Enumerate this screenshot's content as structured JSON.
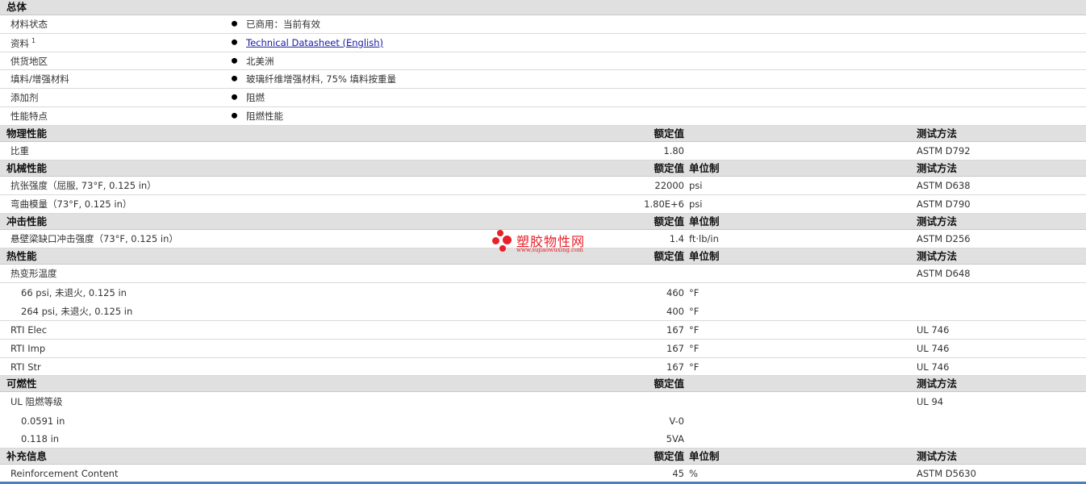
{
  "general": {
    "title": "总体",
    "rows": [
      {
        "label": "材料状态",
        "value": "已商用：当前有效"
      },
      {
        "label": "资料",
        "sup": "1",
        "value": "Technical Datasheet (English)"
      },
      {
        "label": "供货地区",
        "value": "北美洲"
      },
      {
        "label": "填料/增强材料",
        "value": "玻璃纤维增强材料, 75% 填料按重量"
      },
      {
        "label": "添加剂",
        "value": "阻燃"
      },
      {
        "label": "性能特点",
        "value": "阻燃性能"
      }
    ]
  },
  "col_headers": {
    "nominal": "额定值",
    "unit": "单位制",
    "test": "测试方法"
  },
  "physical": {
    "title": "物理性能",
    "rows": [
      {
        "label": "比重",
        "value": "1.80",
        "unit": "",
        "test": "ASTM D792"
      }
    ]
  },
  "mechanical": {
    "title": "机械性能",
    "rows": [
      {
        "label": "抗张强度（屈服, 73°F, 0.125 in）",
        "value": "22000",
        "unit": "psi",
        "test": "ASTM D638"
      },
      {
        "label": "弯曲模量（73°F, 0.125 in）",
        "value": "1.80E+6",
        "unit": "psi",
        "test": "ASTM D790"
      }
    ]
  },
  "impact": {
    "title": "冲击性能",
    "rows": [
      {
        "label": "悬壁梁缺口冲击强度（73°F, 0.125 in）",
        "value": "1.4",
        "unit": "ft·lb/in",
        "test": "ASTM D256"
      }
    ]
  },
  "thermal": {
    "title": "热性能",
    "rows": [
      {
        "label": "热变形温度",
        "value": "",
        "unit": "",
        "test": "ASTM D648"
      },
      {
        "label": "66 psi, 未退火, 0.125 in",
        "value": "460",
        "unit": "°F",
        "test": ""
      },
      {
        "label": "264 psi, 未退火, 0.125 in",
        "value": "400",
        "unit": "°F",
        "test": ""
      },
      {
        "label": "RTI Elec",
        "value": "167",
        "unit": "°F",
        "test": "UL 746"
      },
      {
        "label": "RTI Imp",
        "value": "167",
        "unit": "°F",
        "test": "UL 746"
      },
      {
        "label": "RTI Str",
        "value": "167",
        "unit": "°F",
        "test": "UL 746"
      }
    ]
  },
  "flammability": {
    "title": "可燃性",
    "rows": [
      {
        "label": "UL 阻燃等级",
        "value": "",
        "test": "UL 94"
      },
      {
        "label": "0.0591 in",
        "value": "V-0",
        "test": ""
      },
      {
        "label": "0.118 in",
        "value": "5VA",
        "test": ""
      }
    ]
  },
  "supplemental": {
    "title": "补充信息",
    "rows": [
      {
        "label": "Reinforcement Content",
        "value": "45",
        "unit": "%",
        "test": "ASTM D5630"
      }
    ]
  },
  "watermark": {
    "name": "塑胶物性网",
    "url": "www.sujiaowuxing.com",
    "color": "#e8202a"
  }
}
